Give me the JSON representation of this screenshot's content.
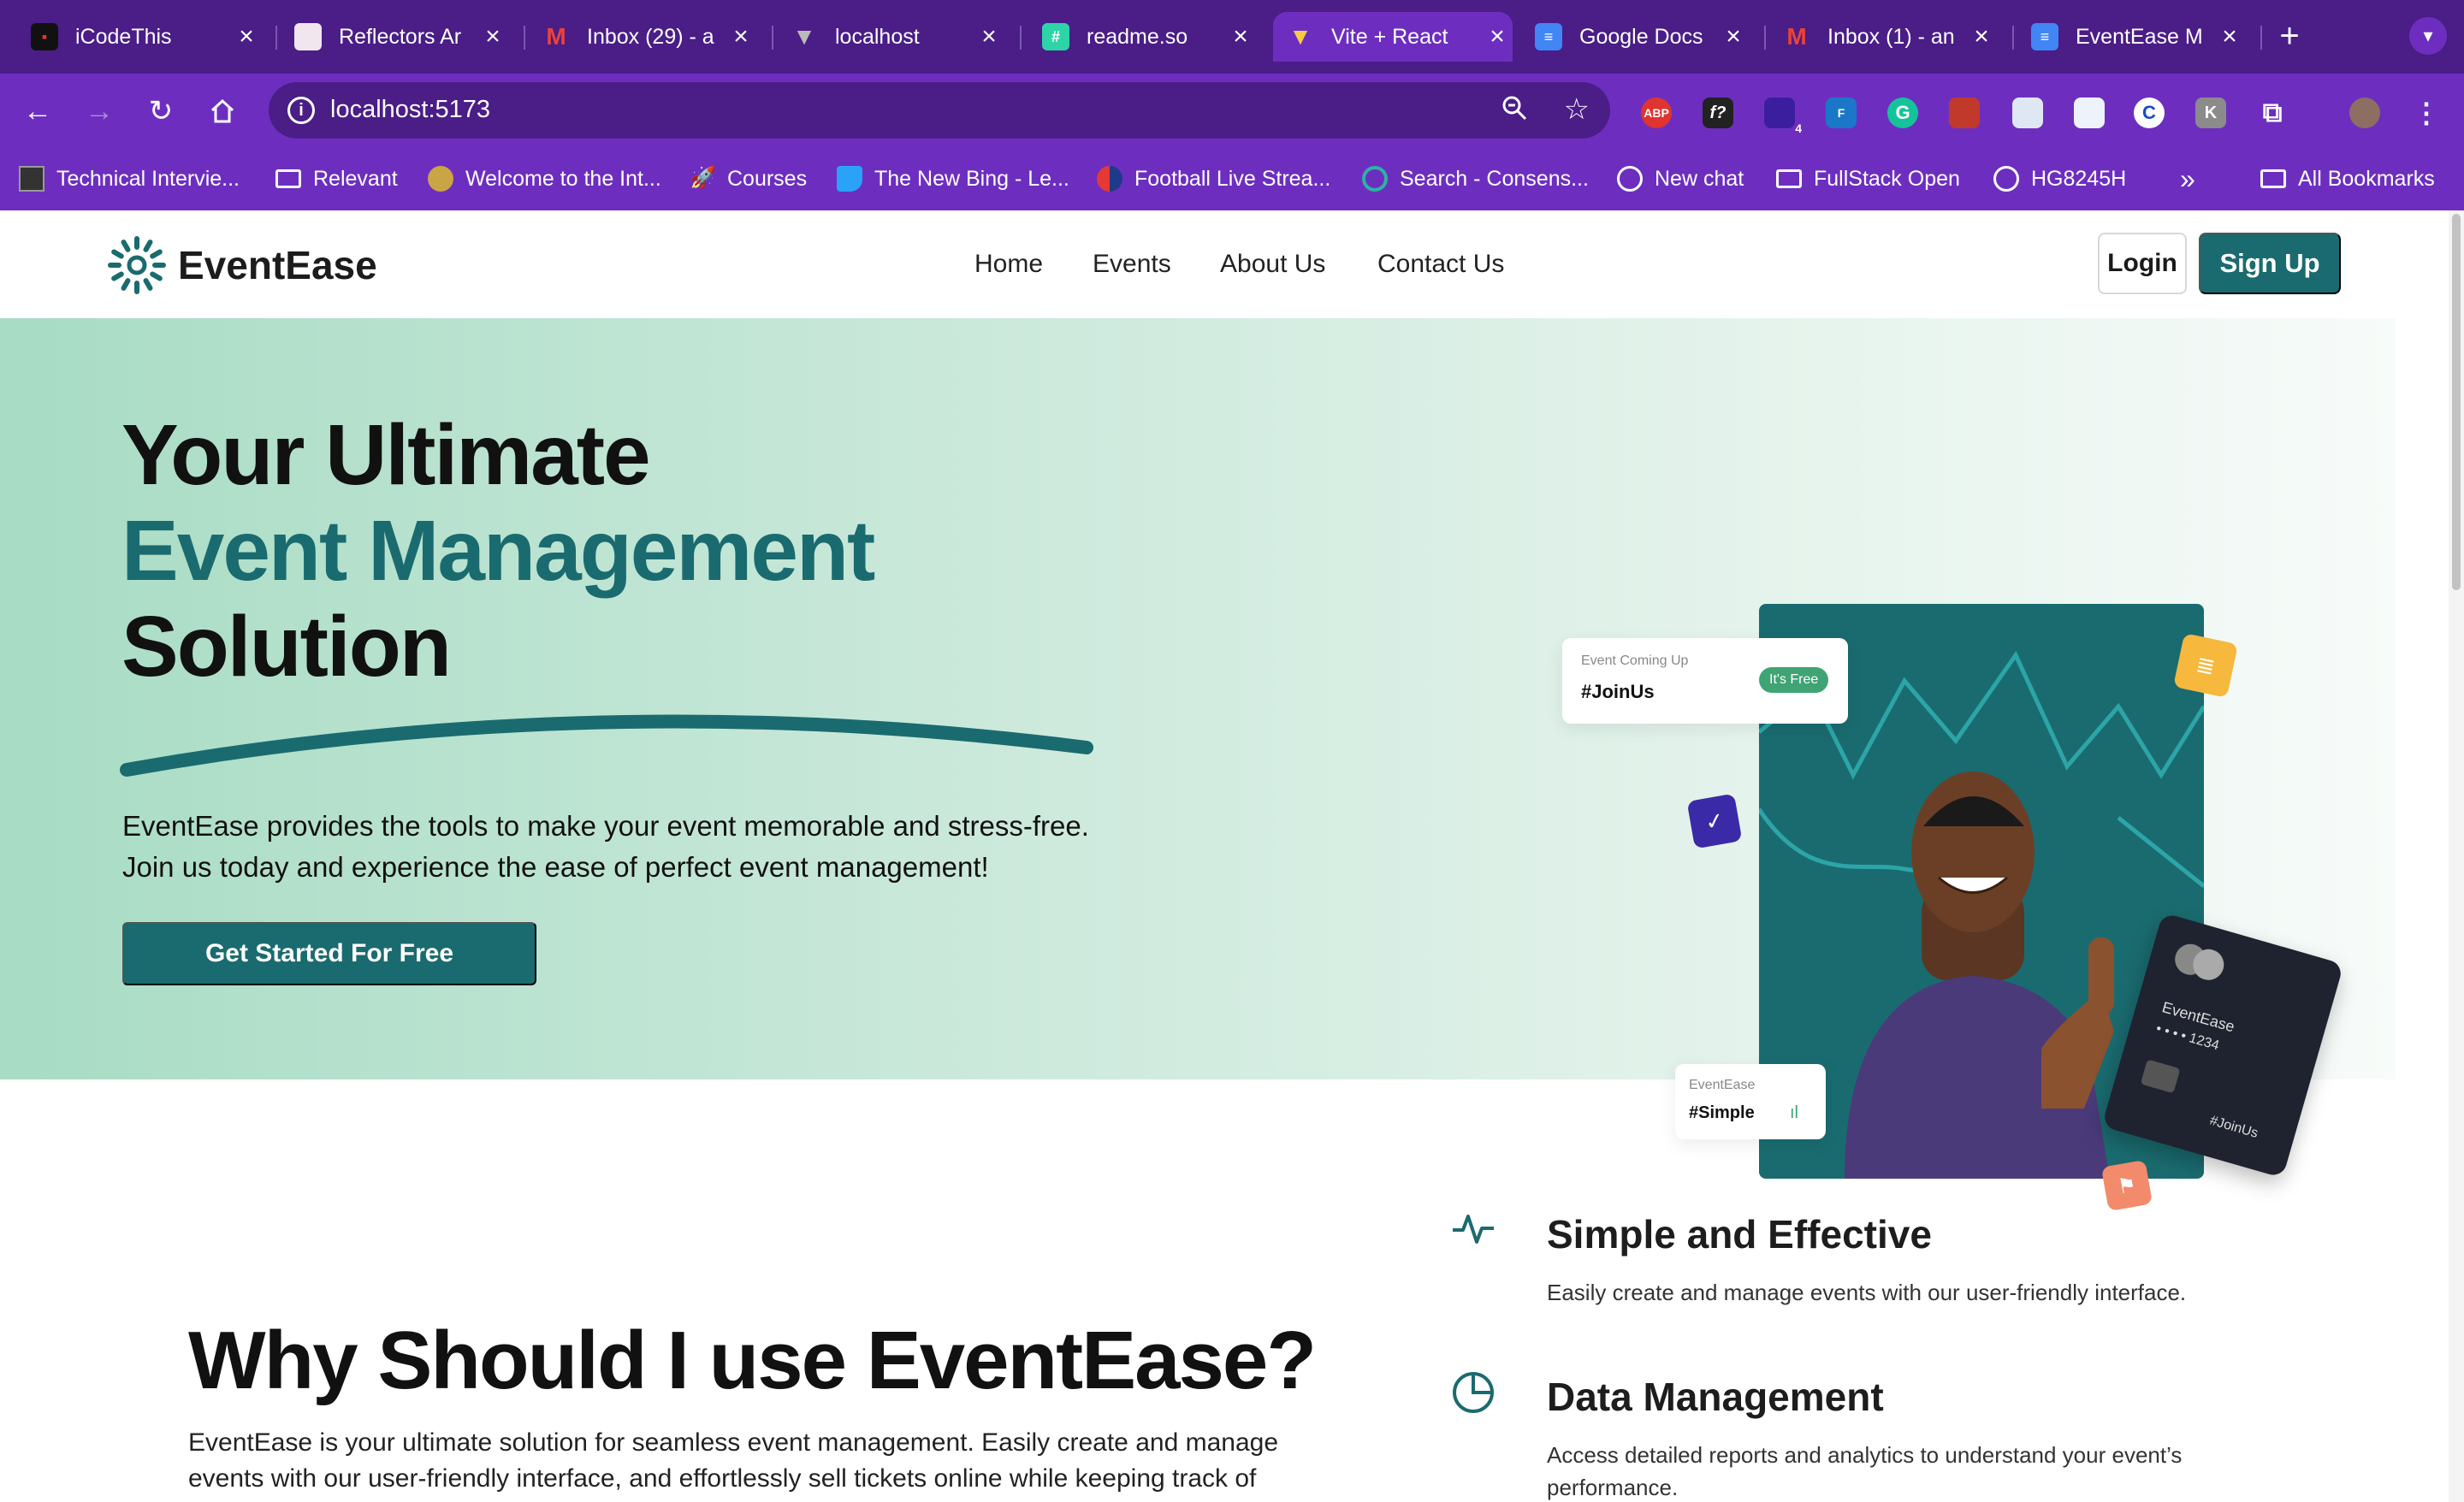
{
  "browser": {
    "tabs": [
      {
        "label": "iCodeThis",
        "icon": "icodethis-icon",
        "color": "#111111"
      },
      {
        "label": "Reflectors Ar",
        "icon": "reflectors-icon",
        "color": "#ffffff"
      },
      {
        "label": "Inbox (29) - a",
        "icon": "gmail-icon",
        "color": "#ea4335"
      },
      {
        "label": "localhost",
        "icon": "localhost-icon",
        "color": "#bbbbbb"
      },
      {
        "label": "readme.so",
        "icon": "readme-icon",
        "color": "#2dd4a7"
      },
      {
        "label": "Vite + React",
        "icon": "vite-icon",
        "color": "#a855f7"
      },
      {
        "label": "Google Docs",
        "icon": "docs-icon",
        "color": "#4285f4"
      },
      {
        "label": "Inbox (1) - an",
        "icon": "gmail-icon",
        "color": "#ea4335"
      },
      {
        "label": "EventEase M",
        "icon": "docs-icon",
        "color": "#4285f4"
      }
    ],
    "active_tab_index": 5,
    "address": "localhost:5173",
    "bookmarks": [
      {
        "label": "Technical Intervie...",
        "icon": "page-icon"
      },
      {
        "label": "Relevant",
        "icon": "folder-icon"
      },
      {
        "label": "Welcome to the Int...",
        "icon": "site-icon"
      },
      {
        "label": "Courses",
        "icon": "rocket-icon"
      },
      {
        "label": "The New Bing - Le...",
        "icon": "bing-icon"
      },
      {
        "label": "Football Live Strea...",
        "icon": "football-icon"
      },
      {
        "label": "Search - Consens...",
        "icon": "consensus-icon"
      },
      {
        "label": "New chat",
        "icon": "chatgpt-icon"
      },
      {
        "label": "FullStack Open",
        "icon": "folder-icon"
      },
      {
        "label": "HG8245H",
        "icon": "globe-icon"
      }
    ],
    "all_bookmarks": "All Bookmarks",
    "more_bookmarks": "»",
    "extension_badge": "4"
  },
  "site": {
    "brand": "EventEase",
    "nav": [
      "Home",
      "Events",
      "About Us",
      "Contact Us"
    ],
    "login": "Login",
    "signup": "Sign Up",
    "accent": "#1a6b6f"
  },
  "hero": {
    "line1": "Your Ultimate",
    "line2": "Event Management",
    "line3": "Solution",
    "desc1": "EventEase provides the tools to make your event memorable and stress-free.",
    "desc2": "Join us today and experience the ease of perfect event management!",
    "cta": "Get Started For Free",
    "card_top_small": "Event Coming Up",
    "card_top_tag": "#JoinUs",
    "card_top_badge": "It's Free",
    "card_bottom_small": "EventEase",
    "card_bottom_tag": "#Simple",
    "credit_brand": "EventEase",
    "credit_number": "• • • •  1234",
    "credit_tag": "#JoinUs"
  },
  "why": {
    "title": "Why Should I use EventEase?",
    "desc": "EventEase is your ultimate solution for seamless event management. Easily create and manage events with our user-friendly interface, and effortlessly sell tickets online while keeping track of",
    "features": [
      {
        "title": "Simple and Effective",
        "desc": "Easily create and manage events with our user-friendly interface.",
        "icon": "activity-icon"
      },
      {
        "title": "Data Management",
        "desc": "Access detailed reports and analytics to understand your event’s performance.",
        "icon": "pie-chart-icon"
      }
    ]
  }
}
